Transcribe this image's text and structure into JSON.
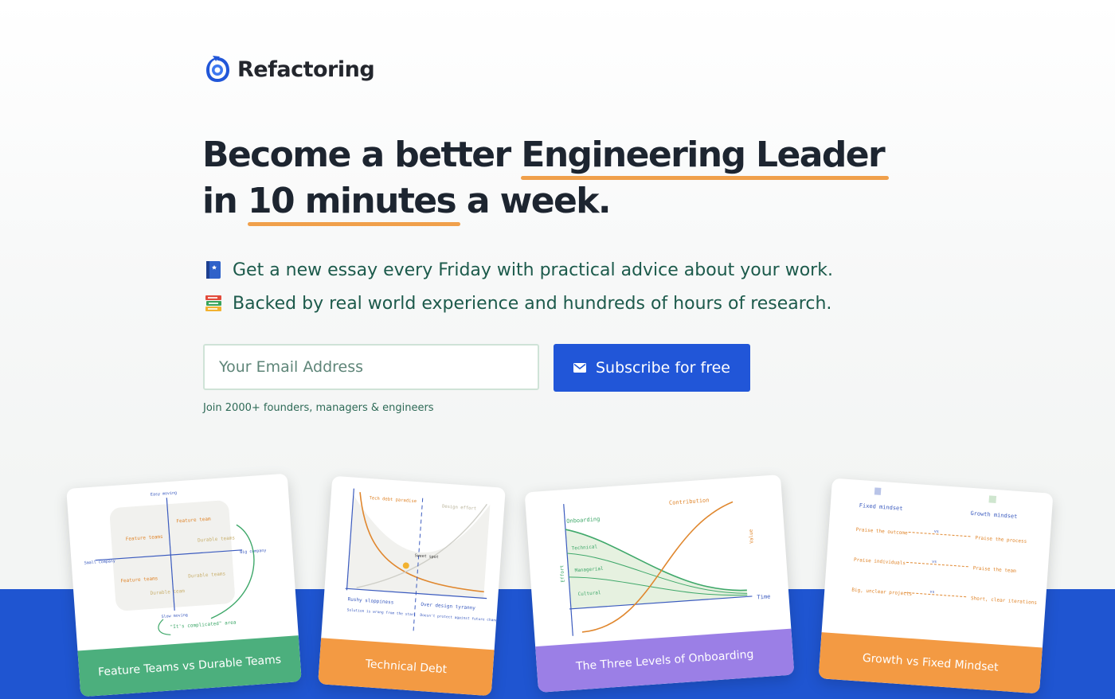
{
  "brand": {
    "name": "Refactoring"
  },
  "hero": {
    "title_part1": "Become a better ",
    "title_highlight1": "Engineering Leader",
    "title_part2": "in ",
    "title_highlight2": "10 minutes",
    "title_part3": " a week."
  },
  "bullets": [
    {
      "icon": "blue-book-icon",
      "text": "Get a new essay every Friday with practical advice about your work."
    },
    {
      "icon": "books-stack-icon",
      "text": "Backed by real world experience and hundreds of hours of research."
    }
  ],
  "signup": {
    "placeholder": "Your Email Address",
    "button_label": "Subscribe for free",
    "join_text": "Join 2000+ founders, managers & engineers"
  },
  "cards": [
    {
      "title": "Feature Teams vs Durable Teams",
      "color": "#4caf7d",
      "labels": {
        "top": "Easy moving",
        "feature_teams": "Feature teams",
        "feature_team": "Feature team",
        "durable_teams": "Durable teams",
        "feature_teams2": "Feature teams",
        "durable_team": "Durable team",
        "durable_teams2": "Durable teams",
        "small": "Small company",
        "big": "Big company",
        "slow": "Slow moving",
        "complicated": "\"It's complicated\" area"
      }
    },
    {
      "title": "Technical Debt",
      "color": "#f39a43",
      "labels": {
        "tdp": "Tech debt paradise",
        "ode": "Design effort",
        "sweet": "Sweet spot",
        "rushy": "Rushy sloppiness",
        "rushy_sub": "Solution is wrong from the start",
        "tyranny": "Over design tyranny",
        "tyranny_sub": "Doesn't protect against future changes"
      }
    },
    {
      "title": "The Three Levels of Onboarding",
      "color": "#9b7fe6",
      "labels": {
        "onboarding": "Onboarding",
        "contribution": "Contribution",
        "technical": "Technical",
        "managerial": "Managerial",
        "cultural": "Cultural",
        "effort": "Effort",
        "value": "Value",
        "time": "Time"
      }
    },
    {
      "title": "Growth vs Fixed Mindset",
      "color": "#f39a43",
      "labels": {
        "fixed": "Fixed mindset",
        "growth": "Growth mindset",
        "r1l": "Praise the outcome",
        "r1r": "Praise the process",
        "r2l": "Praise individuals",
        "r2r": "Praise the team",
        "r3l": "Big, unclear projects",
        "r3r": "Short, clear iterations",
        "vs": "vs"
      }
    }
  ],
  "colors": {
    "accent": "#2156d8",
    "highlight": "#f0a04b",
    "text_green": "#1c5a4b"
  }
}
